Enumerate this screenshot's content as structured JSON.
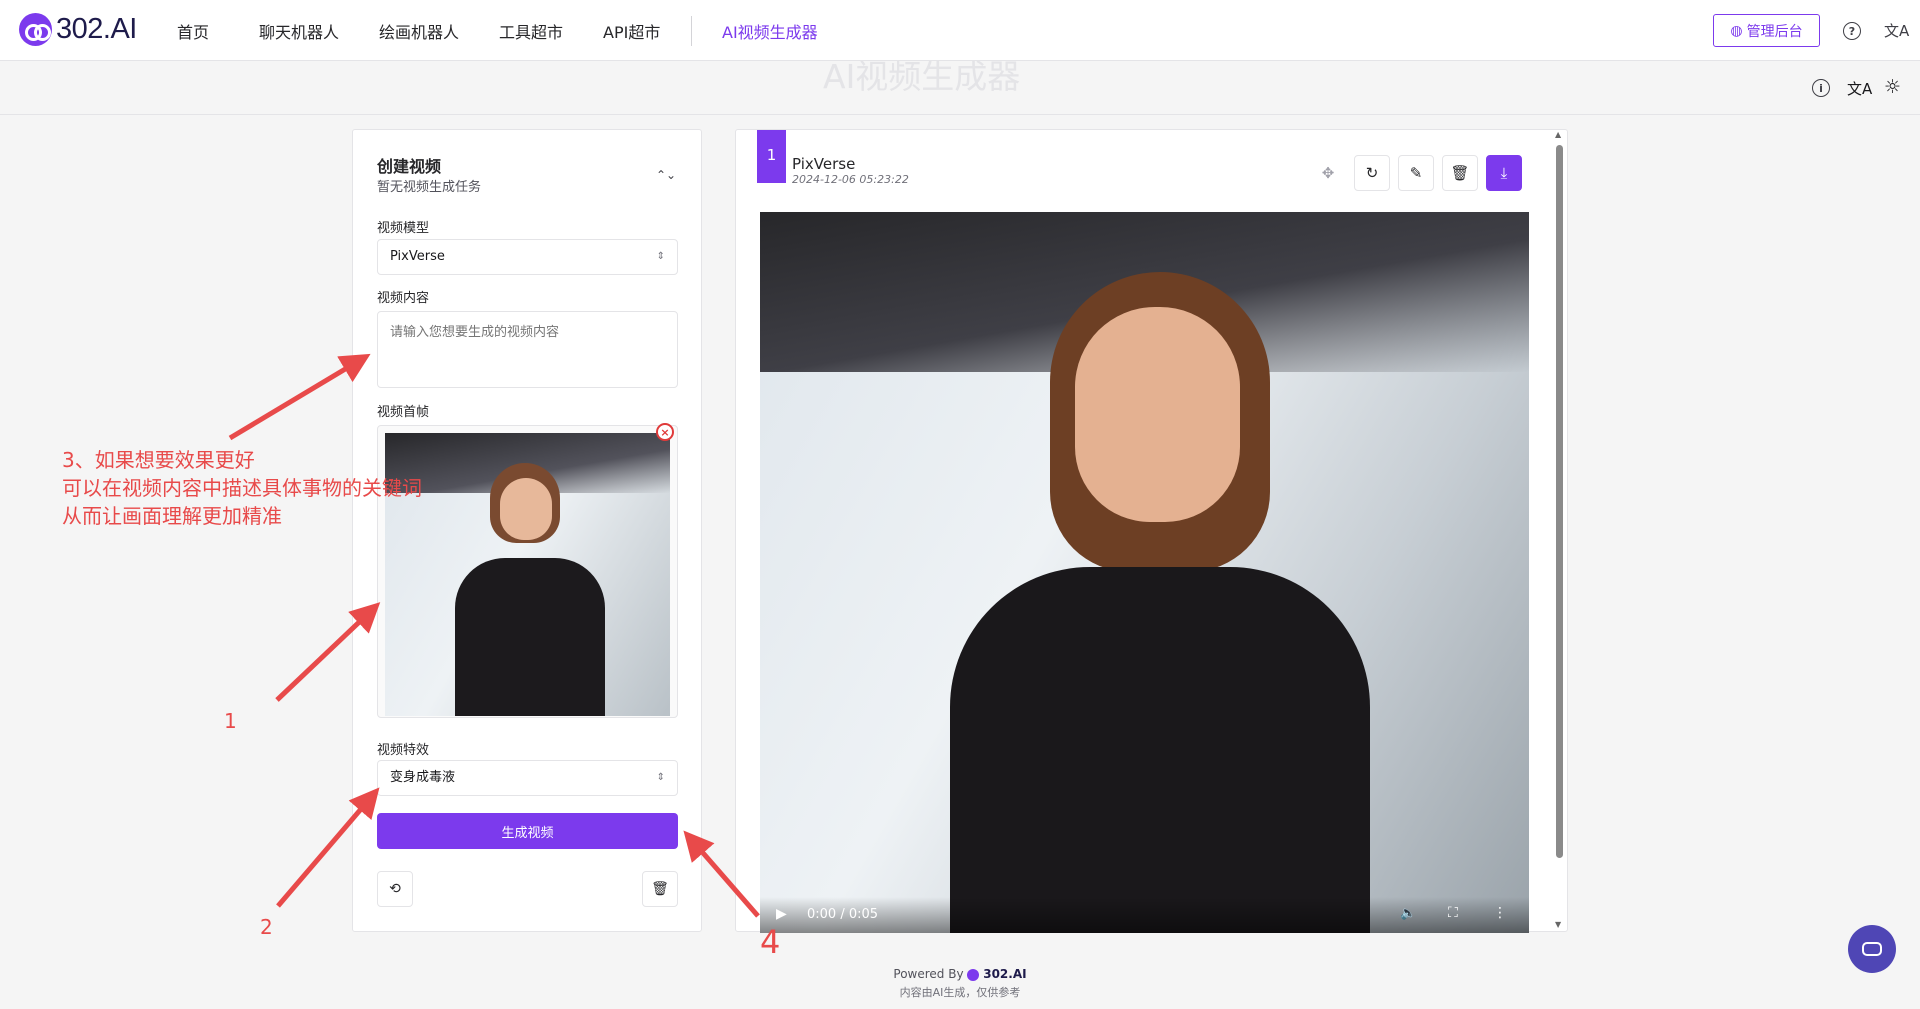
{
  "nav": {
    "brand": "302.AI",
    "items": [
      "首页",
      "聊天机器人",
      "绘画机器人",
      "工具超市",
      "API超市",
      "AI视频生成器"
    ],
    "admin": "管理后台"
  },
  "page": {
    "ghost_title": "AI视频生成器"
  },
  "form": {
    "title": "创建视频",
    "subtitle": "暂无视频生成任务",
    "model_label": "视频模型",
    "model_value": "PixVerse",
    "content_label": "视频内容",
    "content_placeholder": "请输入您想要生成的视频内容",
    "frame_label": "视频首帧",
    "effect_label": "视频特效",
    "effect_value": "变身成毒液",
    "generate": "生成视频"
  },
  "result": {
    "index": "1",
    "model": "PixVerse",
    "timestamp": "2024-12-06 05:23:22",
    "time": "0:00 / 0:05",
    "progress": 0
  },
  "annotations": {
    "a3_line1": "3、如果想要效果更好",
    "a3_line2": "可以在视频内容中描述具体事物的关键词",
    "a3_line3": "从而让画面理解更加精准",
    "n1": "1",
    "n2": "2",
    "n4": "4"
  },
  "footer": {
    "powered": "Powered By",
    "brand": "302.AI",
    "note": "内容由AI生成，仅供参考"
  },
  "colors": {
    "accent": "#7c3aed",
    "annotation": "#e84a4a"
  }
}
